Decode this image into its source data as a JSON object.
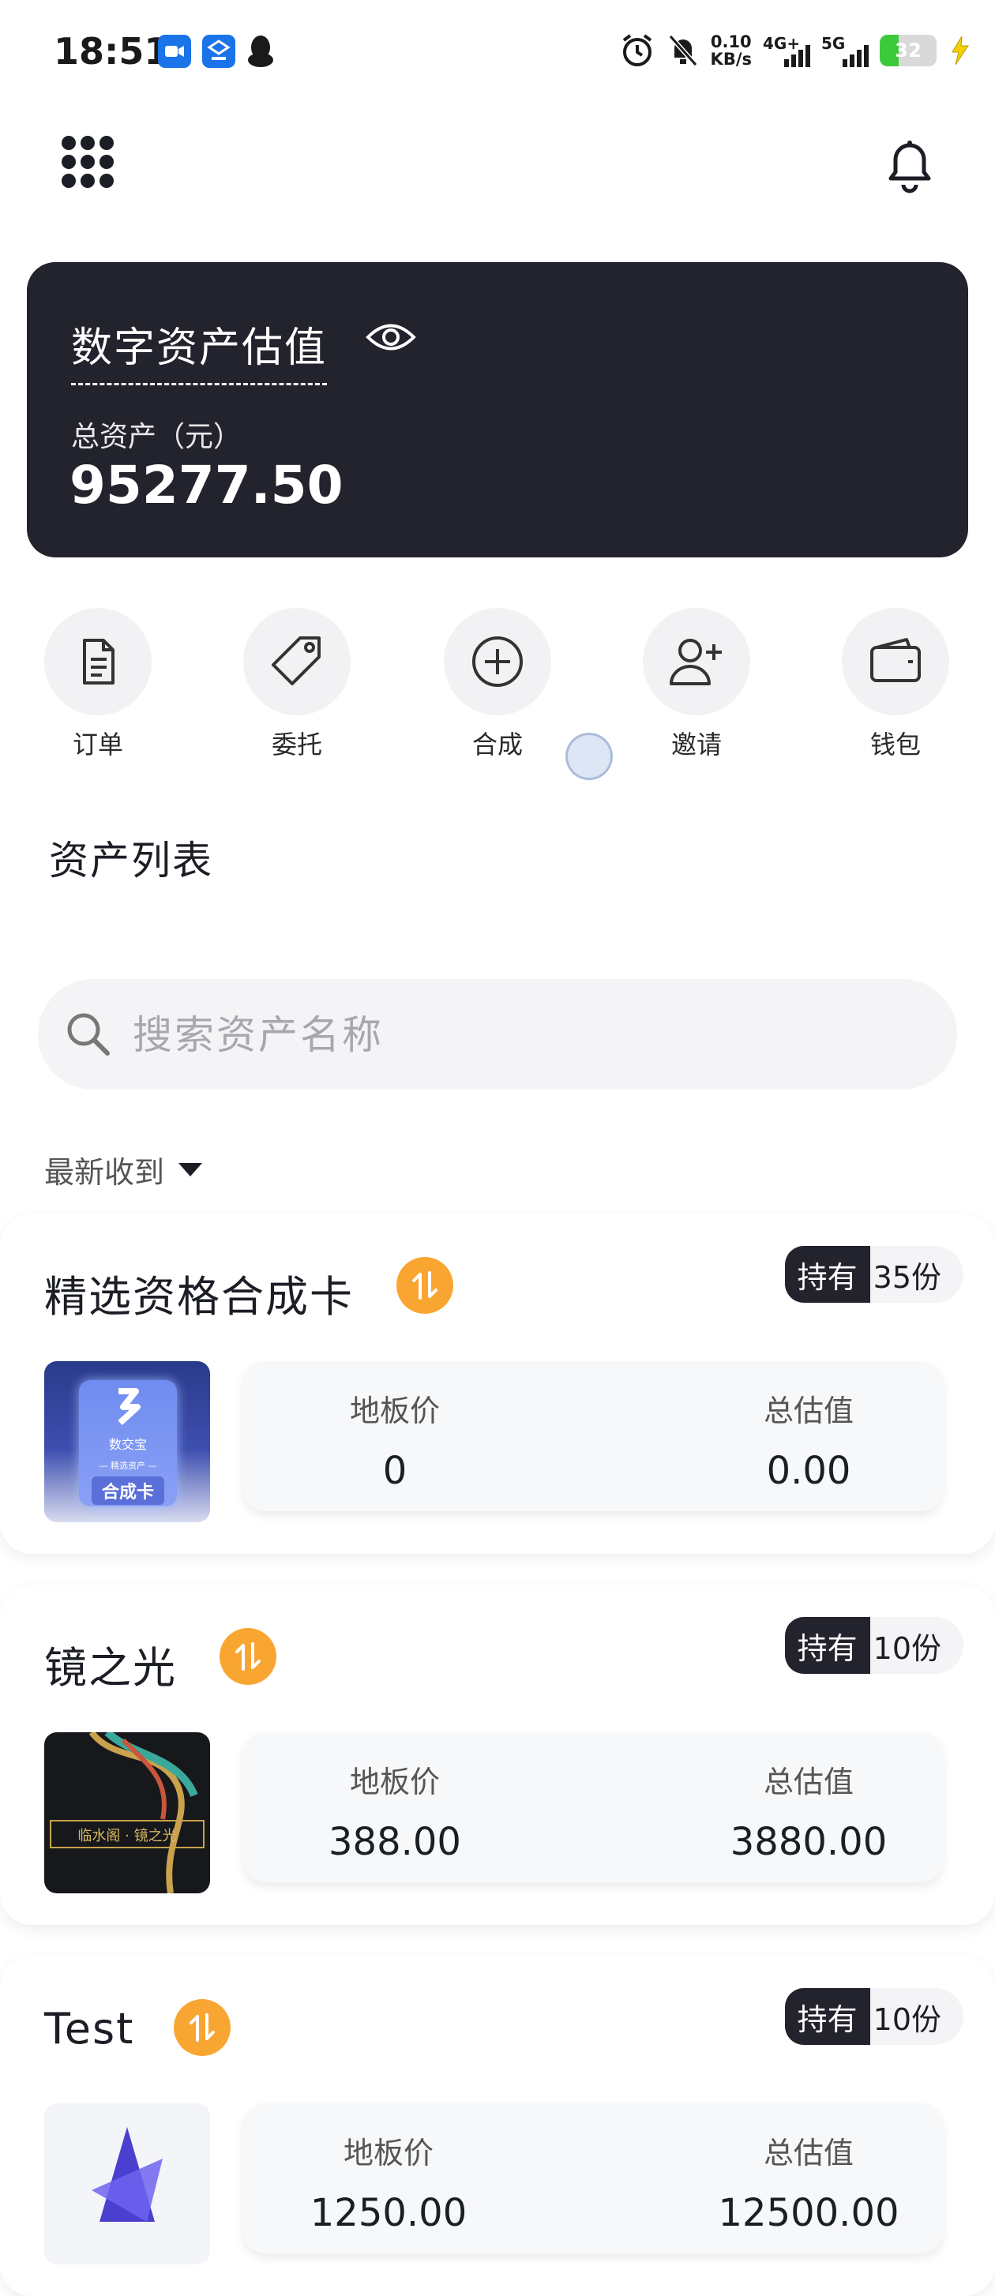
{
  "status_bar": {
    "time": "18:51",
    "net_speed_value": "0.10",
    "net_speed_unit": "KB/s",
    "sim1_label": "4G+",
    "sim2_label": "5G",
    "battery_level": "32",
    "icons": [
      "video-app-icon",
      "scan-app-icon",
      "qq-icon",
      "alarm-icon",
      "mute-icon",
      "signal-icon",
      "battery-icon",
      "charging-icon"
    ]
  },
  "header": {
    "menu_icon": "grid-menu-icon",
    "bell_icon": "bell-icon"
  },
  "asset_card": {
    "title": "数字资产估值",
    "total_label": "总资产（元）",
    "total_value": "95277.50"
  },
  "actions": [
    {
      "label": "订单",
      "icon": "document-icon"
    },
    {
      "label": "委托",
      "icon": "tag-icon"
    },
    {
      "label": "合成",
      "icon": "plus-circle-icon"
    },
    {
      "label": "邀请",
      "icon": "add-user-icon"
    },
    {
      "label": "钱包",
      "icon": "wallet-icon"
    }
  ],
  "section_title": "资产列表",
  "search": {
    "placeholder": "搜索资产名称"
  },
  "sort": {
    "label": "最新收到"
  },
  "items": [
    {
      "name": "精选资格合成卡",
      "hold_label": "持有",
      "hold_value": "35份",
      "floor_label": "地板价",
      "floor_value": "0",
      "total_label": "总估值",
      "total_value": "0.00",
      "thumb_brand": "数交宝",
      "thumb_sub": "— 精选资产 —",
      "thumb_card": "合成卡"
    },
    {
      "name": "镜之光",
      "hold_label": "持有",
      "hold_value": "10份",
      "floor_label": "地板价",
      "floor_value": "388.00",
      "total_label": "总估值",
      "total_value": "3880.00",
      "thumb_caption": "临水阁 · 镜之光"
    },
    {
      "name": "Test",
      "hold_label": "持有",
      "hold_value": "10份",
      "floor_label": "地板价",
      "floor_value": "1250.00",
      "total_label": "总估值",
      "total_value": "12500.00"
    }
  ],
  "colors": {
    "dark_card": "#22232c",
    "swap_orange": "#f9a531",
    "light_bg": "#f4f4f6"
  }
}
